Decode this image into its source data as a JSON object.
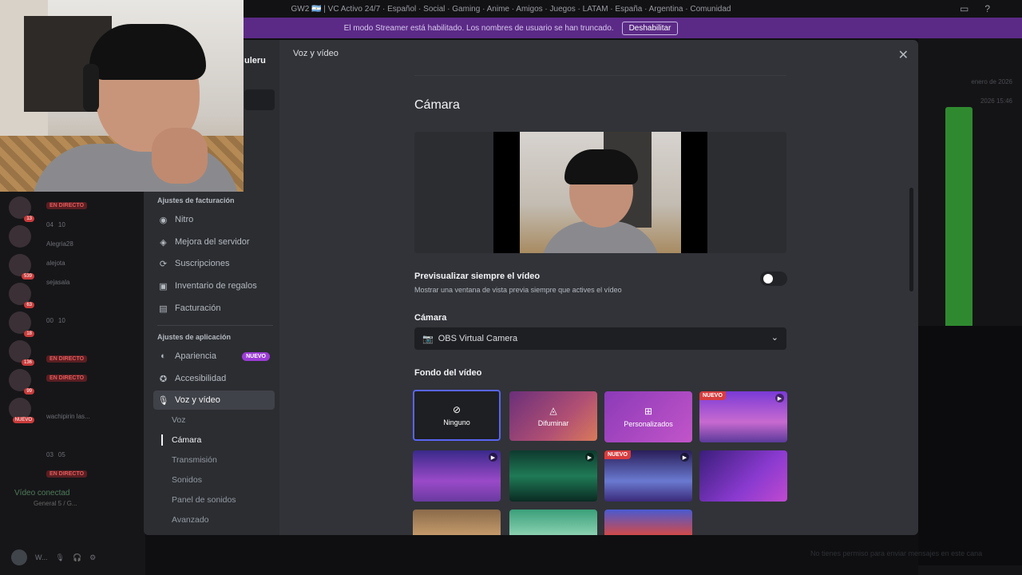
{
  "titlebar": {
    "title": "GW2 🇦🇷 | VC Activo 24/7 · Español · Social · Gaming · Anime · Amigos · Juegos · LATAM · España · Argentina · Comunidad"
  },
  "streamer_bar": {
    "text": "El modo Streamer está habilitado. Los nombres de usuario se han truncado.",
    "button": "Deshabilitar"
  },
  "background": {
    "live_label": "EN DIRECTO",
    "voice_connected": "Vídeo conectad",
    "voice_channel": "General 5 / G...",
    "channel_rows": [
      "Alegria28",
      "alejota",
      "sejasala",
      "wachipirin las..."
    ],
    "counts": [
      "04",
      "10",
      "00",
      "10",
      "03",
      "05"
    ],
    "right_dates": [
      "enero de 2026",
      "2026 15:46"
    ],
    "bottom_hint": "No tienes permiso para enviar mensajes en este cana",
    "user_initial": "W..."
  },
  "modal": {
    "header": "Voz y vídeo",
    "close_icon": "close-icon",
    "sidebar": {
      "user_name": "uleru",
      "billing_section": "Ajustes de facturación",
      "billing_items": [
        {
          "label": "Nitro",
          "icon": "nitro-icon"
        },
        {
          "label": "Mejora del servidor",
          "icon": "boost-icon"
        },
        {
          "label": "Suscripciones",
          "icon": "subscriptions-icon"
        },
        {
          "label": "Inventario de regalos",
          "icon": "gift-icon"
        },
        {
          "label": "Facturación",
          "icon": "billing-icon"
        }
      ],
      "app_section": "Ajustes de aplicación",
      "app_items": [
        {
          "label": "Apariencia",
          "icon": "palette-icon",
          "badge": "NUEVO"
        },
        {
          "label": "Accesibilidad",
          "icon": "accessibility-icon"
        },
        {
          "label": "Voz y vídeo",
          "icon": "microphone-icon"
        }
      ],
      "sub_items": [
        "Voz",
        "Cámara",
        "Transmisión",
        "Sonidos",
        "Panel de sonidos",
        "Avanzado"
      ]
    },
    "content": {
      "section_title": "Cámara",
      "always_preview_title": "Previsualizar siempre el vídeo",
      "always_preview_desc": "Mostrar una ventana de vista previa siempre que actives el vídeo",
      "always_preview_on": false,
      "camera_label": "Cámara",
      "camera_value": "OBS Virtual Camera",
      "background_label": "Fondo del vídeo",
      "tiles": [
        {
          "label": "Ninguno",
          "icon": "⊘",
          "kind": "none"
        },
        {
          "label": "Difuminar",
          "icon": "◬",
          "kind": "blur"
        },
        {
          "label": "Personalizados",
          "icon": "⊞",
          "kind": "custom"
        },
        {
          "label": "",
          "kind": "scene",
          "badge": "NUEVO",
          "play": true
        },
        {
          "label": "",
          "kind": "scene",
          "play": true
        },
        {
          "label": "",
          "kind": "scene",
          "play": true
        },
        {
          "label": "",
          "kind": "scene",
          "badge": "NUEVO",
          "play": true
        },
        {
          "label": "",
          "kind": "scene"
        },
        {
          "label": "",
          "kind": "scene"
        },
        {
          "label": "",
          "kind": "scene"
        },
        {
          "label": "",
          "kind": "scene"
        }
      ]
    }
  },
  "colors": {
    "accent": "#5865f2",
    "new_badge": "#9b3cd6",
    "streamer_bar": "#5b2a86",
    "live_red": "#e05b5b"
  }
}
